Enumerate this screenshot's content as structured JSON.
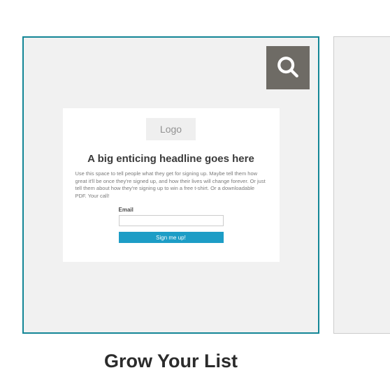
{
  "templates": [
    {
      "title": "Grow Your List",
      "preview": {
        "logo_text": "Logo",
        "headline": "A big enticing headline goes here",
        "description": "Use this space to tell people what they get for signing up. Maybe tell them how great it'll be once they're signed up, and how their lives will change forever. Or just tell them about how they're signing up to win a free t-shirt. Or a downloadable PDF. Your call!",
        "email_label": "Email",
        "button_label": "Sign me up!"
      }
    }
  ],
  "icons": {
    "zoom": "search"
  }
}
